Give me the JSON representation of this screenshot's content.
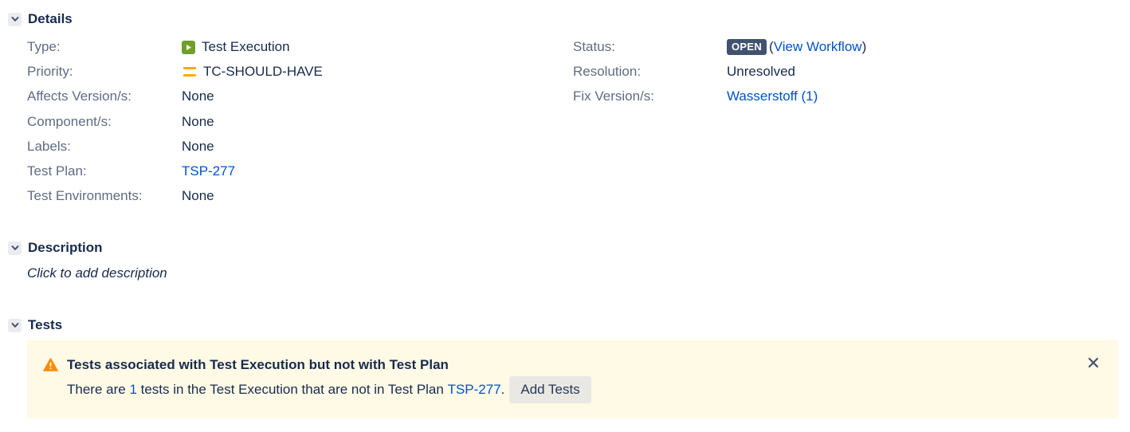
{
  "details": {
    "title": "Details",
    "left_fields": [
      {
        "label": "Type:",
        "value": "Test Execution"
      },
      {
        "label": "Priority:",
        "value": "TC-SHOULD-HAVE"
      },
      {
        "label": "Affects Version/s:",
        "value": "None"
      },
      {
        "label": "Component/s:",
        "value": "None"
      },
      {
        "label": "Labels:",
        "value": "None"
      },
      {
        "label": "Test Plan:",
        "value": "TSP-277"
      },
      {
        "label": "Test Environments:",
        "value": "None"
      }
    ],
    "right_fields": {
      "status_label": "Status:",
      "status_badge": "OPEN",
      "status_paren_open": "(",
      "view_workflow": "View Workflow",
      "status_paren_close": ")",
      "resolution_label": "Resolution:",
      "resolution_value": "Unresolved",
      "fix_label": "Fix Version/s:",
      "fix_value": "Wasserstoff (1)"
    }
  },
  "description": {
    "title": "Description",
    "placeholder": "Click to add description"
  },
  "tests": {
    "title": "Tests",
    "warning": {
      "title": "Tests associated with Test Execution but not with Test Plan",
      "body_prefix": "There are ",
      "count": "1",
      "body_middle": " tests in the Test Execution that are not in Test Plan ",
      "plan_link": "TSP-277",
      "body_suffix": ".",
      "button": "Add Tests"
    }
  },
  "icons": {
    "collapse": "chevron-down-icon",
    "type": "test-execution-icon",
    "priority": "priority-medium-icon",
    "warning": "warning-icon",
    "close": "close-icon"
  },
  "colors": {
    "link": "#0052cc",
    "warning_bg": "#fffae6",
    "lozenge": "#42526e",
    "priority": "#ffab00",
    "type_icon": "#6ea02a",
    "warning_icon": "#ff8b00"
  }
}
